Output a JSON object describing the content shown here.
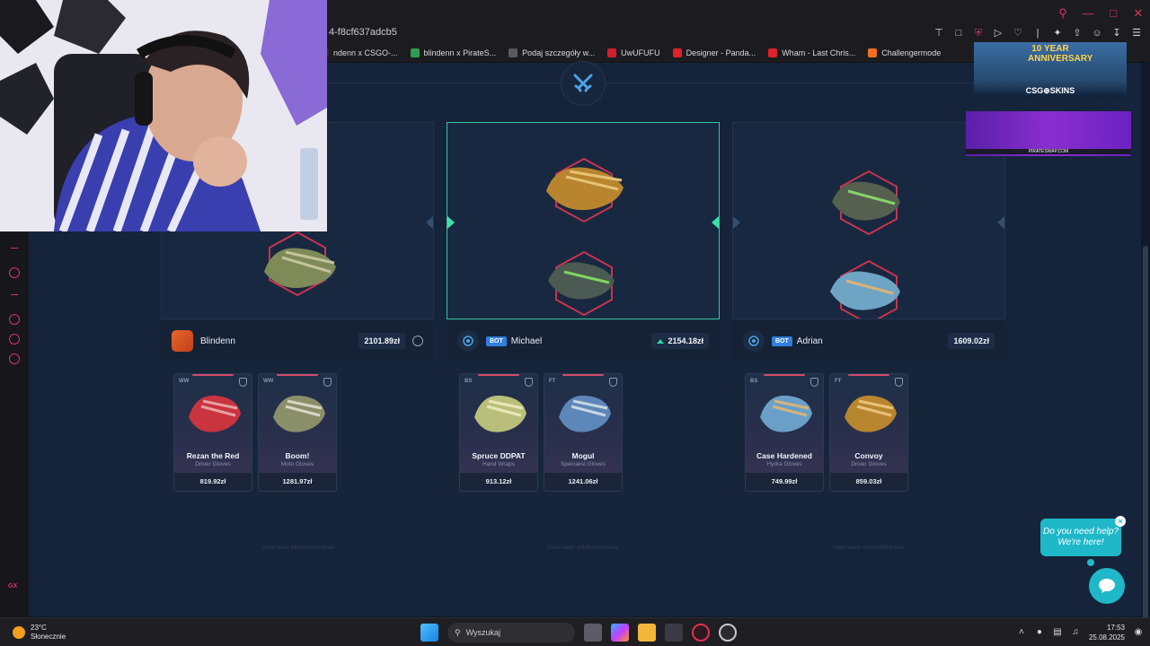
{
  "browser": {
    "url_fragment": "4-f8cf637adcb5",
    "bookmarks": [
      {
        "label": "ndenn x CSGO-...",
        "color": "#2c2c2c"
      },
      {
        "label": "blindenn x PirateS...",
        "color": "#2e9e4f"
      },
      {
        "label": "Podaj szczegóły w...",
        "color": "#5a5a5a"
      },
      {
        "label": "UwUFUFU",
        "color": "#d02030"
      },
      {
        "label": "Designer - Panda...",
        "color": "#e0202a"
      },
      {
        "label": "Wham - Last Chris...",
        "color": "#e0202a"
      },
      {
        "label": "Challengermode",
        "color": "#f07020"
      }
    ]
  },
  "ads": {
    "ad1_anniversary": "10 YEAR ANNIVERSARY",
    "ad1_brand": "CSG⊕SKINS",
    "ad2_brand": "PIRATESWAP.COM"
  },
  "players": [
    {
      "name": "Blindenn",
      "is_bot": false,
      "total": "2101.89zł",
      "trend_up": false,
      "client_seed": "Client seed: ef4d0e994dfabae",
      "items": [
        {
          "cond": "WW",
          "name": "Rezan the Red",
          "type": "Driver Gloves",
          "price": "819.92zł",
          "c1": "#c9343f",
          "c2": "#e8a0a0"
        },
        {
          "cond": "WW",
          "name": "Boom!",
          "type": "Moto Gloves",
          "price": "1281.97zł",
          "c1": "#8a8f6a",
          "c2": "#d8d6c4"
        }
      ]
    },
    {
      "name": "Michael",
      "is_bot": true,
      "bot_label": "BOT",
      "total": "2154.18zł",
      "trend_up": true,
      "client_seed": "Client seed: ef4d0e994dfabae",
      "items": [
        {
          "cond": "BS",
          "name": "Spruce DDPAT",
          "type": "Hand Wraps",
          "price": "913.12zł",
          "c1": "#b9bf7a",
          "c2": "#e8e6b8"
        },
        {
          "cond": "FT",
          "name": "Mogul",
          "type": "Specialist Gloves",
          "price": "1241.06zł",
          "c1": "#5d87b8",
          "c2": "#c8d6e2"
        }
      ]
    },
    {
      "name": "Adrian",
      "is_bot": true,
      "bot_label": "BOT",
      "total": "1609.02zł",
      "trend_up": false,
      "client_seed": "Client seed: ef4d0e994dfabae",
      "items": [
        {
          "cond": "BS",
          "name": "Case Hardened",
          "type": "Hydra Gloves",
          "price": "749.99zł",
          "c1": "#6aa0c8",
          "c2": "#d8b27a"
        },
        {
          "cond": "FT",
          "name": "Convoy",
          "type": "Driver Gloves",
          "price": "859.03zł",
          "c1": "#b8862e",
          "c2": "#e8c27a"
        }
      ]
    }
  ],
  "chat": {
    "line1": "Do you need help?",
    "line2": "We're here!",
    "close": "×"
  },
  "taskbar": {
    "temp": "23°C",
    "weather": "Słonecznie",
    "search_placeholder": "Wyszukaj",
    "time": "17:53",
    "date": "25.08.2025"
  },
  "colors": {
    "accent": "#34c7a1",
    "opera_red": "#d8345f",
    "bot_blue": "#2f7fe0",
    "chat_teal": "#1fb8c9"
  }
}
